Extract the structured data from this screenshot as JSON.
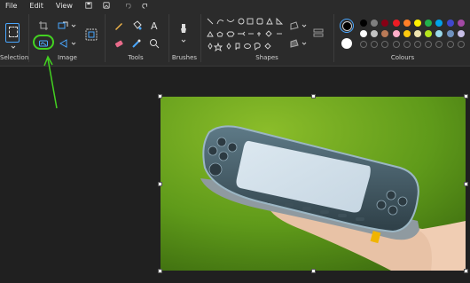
{
  "menu": {
    "file": "File",
    "edit": "Edit",
    "view": "View",
    "icons": [
      "save-icon",
      "image-properties-icon",
      "undo-icon",
      "redo-icon"
    ]
  },
  "ribbon": {
    "groups": {
      "selection": "Selection",
      "image": "Image",
      "tools": "Tools",
      "brushes": "Brushes",
      "shapes": "Shapes",
      "colours": "Colours"
    },
    "text_tool_glyph": "A"
  },
  "palette": {
    "primary": "#000000",
    "secondary": "#ffffff",
    "row1": [
      "#000000",
      "#7f7f7f",
      "#880015",
      "#ed1c24",
      "#ff7f27",
      "#fff200",
      "#22b14c",
      "#00a2e8",
      "#3f48cc",
      "#a349a4"
    ],
    "row2": [
      "#ffffff",
      "#c3c3c3",
      "#b97a57",
      "#ffaec9",
      "#ffc90e",
      "#efe4b0",
      "#b5e61d",
      "#99d9ea",
      "#7092be",
      "#c8bfe7"
    ]
  },
  "annotation": {
    "highlight_color": "#43d121",
    "target": "crop-icon"
  }
}
